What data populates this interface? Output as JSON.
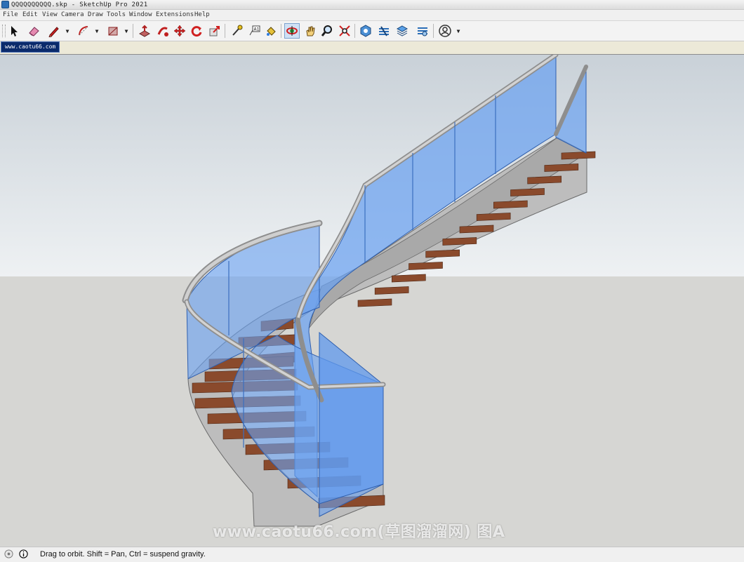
{
  "window": {
    "title": "QQQQQQQQQQ.skp - SketchUp Pro 2021"
  },
  "menu": [
    "File",
    "Edit",
    "View",
    "Camera",
    "Draw",
    "Tools",
    "Window",
    "Extensions",
    "Help"
  ],
  "scene_tabs": [
    {
      "label": "www.caotu66.com",
      "active": true
    }
  ],
  "toolbar": {
    "tools": [
      {
        "icon": "select-arrow-icon"
      },
      {
        "icon": "eraser-icon"
      },
      {
        "icon": "pencil-line-icon",
        "dropdown": true
      },
      {
        "icon": "arc-icon",
        "dropdown": true
      },
      {
        "icon": "rectangle-icon",
        "dropdown": true
      },
      {
        "icon": "push-pull-icon"
      },
      {
        "icon": "follow-me-icon"
      },
      {
        "icon": "move-icon"
      },
      {
        "icon": "rotate-icon"
      },
      {
        "icon": "scale-icon"
      },
      {
        "icon": "tape-measure-icon"
      },
      {
        "icon": "text-label-icon"
      },
      {
        "icon": "paint-bucket-icon"
      },
      {
        "icon": "orbit-icon",
        "active": true
      },
      {
        "icon": "pan-hand-icon"
      },
      {
        "icon": "zoom-icon"
      },
      {
        "icon": "zoom-extents-icon"
      },
      {
        "icon": "warehouse-icon"
      },
      {
        "icon": "extension-warehouse-icon"
      },
      {
        "icon": "layout-icon"
      },
      {
        "icon": "extension-manager-icon"
      },
      {
        "icon": "account-icon",
        "dropdown": true
      }
    ]
  },
  "viewport": {
    "sky_color": "#c9d1d8",
    "ground_color": "#d6d6d3",
    "glass_color": "#6aa1f0",
    "tread_color": "#8a4a2c",
    "stringer_color": "#c0c0c0"
  },
  "watermark": "www.caotu66.com(草图溜溜网) 图A",
  "status": {
    "message": "Drag to orbit. Shift = Pan, Ctrl = suspend gravity."
  }
}
